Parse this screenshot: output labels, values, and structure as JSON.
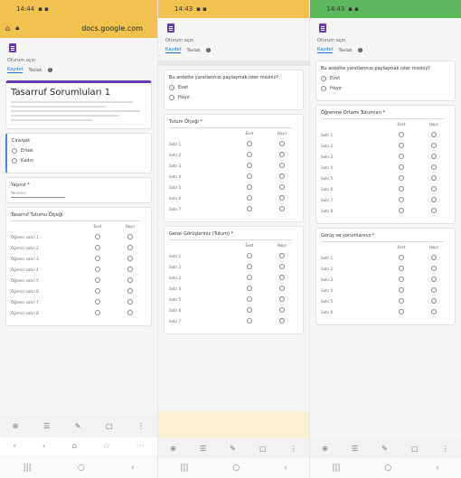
{
  "panels": [
    {
      "time": "14:44",
      "url": "docs.google.com",
      "account": "Oturum açın",
      "tabs": [
        "Kaydet",
        "Taslak"
      ],
      "form_title": "Tasarruf Sorumluları 1",
      "q1": {
        "label": "Cinsiyet",
        "options": [
          "Erkek",
          "Kadın"
        ]
      },
      "q2": {
        "label": "Yaşınız *",
        "placeholder": "Yanıtınız"
      },
      "grid1": {
        "title": "Tasarruf Tutumu Ölçeği",
        "cols": [
          "Evet",
          "Hayır"
        ],
        "rows": [
          "Öğrenci satırı 1",
          "Öğrenci satırı 2",
          "Öğrenci satırı 3",
          "Öğrenci satırı 4",
          "Öğrenci satırı 5",
          "Öğrenci satırı 6",
          "Öğrenci satırı 7",
          "Öğrenci satırı 8"
        ]
      },
      "nav": [
        "⊕",
        "☰",
        "✎",
        "▢",
        "⋮"
      ],
      "browser_nav": [
        "‹",
        "›",
        "⌂",
        "☆",
        "⋯"
      ],
      "sys_nav": [
        "|||",
        "○",
        "‹"
      ]
    },
    {
      "time": "14:43",
      "account": "Oturum açın",
      "tabs": [
        "Kaydet",
        "Taslak"
      ],
      "q1": {
        "label": "Bu ankette yanıtlarınızı paylaşmak ister misiniz?",
        "options": [
          "Evet",
          "Hayır"
        ]
      },
      "grid1": {
        "title": "Tutum Ölçeği *",
        "cols": [
          "Evet",
          "Hayır"
        ],
        "rows": [
          "Satır 1",
          "Satır 2",
          "Satır 3",
          "Satır 4",
          "Satır 5",
          "Satır 6",
          "Satır 7"
        ]
      },
      "grid2": {
        "title": "Genel Görüşleriniz (Tutum) *",
        "cols": [
          "Evet",
          "Hayır"
        ],
        "rows": [
          "Satır 1",
          "Satır 2",
          "Satır 3",
          "Satır 4",
          "Satır 5",
          "Satır 6",
          "Satır 7"
        ]
      },
      "nav": [
        "⊕",
        "☰",
        "✎",
        "▢",
        "⋮"
      ],
      "sys_nav": [
        "|||",
        "○",
        "‹"
      ]
    },
    {
      "time": "14:43",
      "account": "Oturum açın",
      "tabs": [
        "Kaydet",
        "Taslak"
      ],
      "q1": {
        "label": "Bu ankette yanıtlarınızı paylaşmak ister misiniz?",
        "options": [
          "Evet",
          "Hayır"
        ]
      },
      "grid1": {
        "title": "Öğrenme Ortamı Tutumları *",
        "cols": [
          "Evet",
          "Hayır"
        ],
        "rows": [
          "Satır 1",
          "Satır 2",
          "Satır 3",
          "Satır 4",
          "Satır 5",
          "Satır 6",
          "Satır 7",
          "Satır 8"
        ]
      },
      "grid2": {
        "title": "Görüş ve yorumlarınız *",
        "cols": [
          "Evet",
          "Hayır"
        ],
        "rows": [
          "Satır 1",
          "Satır 2",
          "Satır 3",
          "Satır 4",
          "Satır 5",
          "Satır 6",
          "Satır 7"
        ]
      },
      "nav": [
        "⊕",
        "☰",
        "✎",
        "▢",
        "⋮"
      ],
      "sys_nav": [
        "|||",
        "○",
        "‹"
      ]
    }
  ],
  "colors": {
    "p1_header": "#f2c250",
    "p2_header": "#f2c250",
    "p3_header": "#5cb85c",
    "accent": "#673ab7"
  }
}
